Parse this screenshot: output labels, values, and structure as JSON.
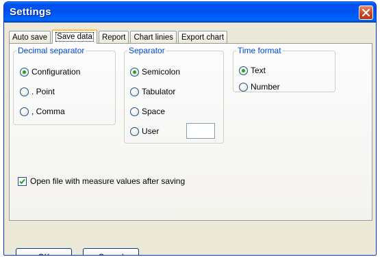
{
  "window": {
    "title": "Settings"
  },
  "tabs": [
    {
      "label": "Auto save"
    },
    {
      "label": "Save data"
    },
    {
      "label": "Report"
    },
    {
      "label": "Chart linies"
    },
    {
      "label": "Export chart"
    }
  ],
  "active_tab": "Save data",
  "decimal_separator": {
    "legend": "Decimal separator",
    "options": [
      {
        "label": "Configuration",
        "checked": true
      },
      {
        "label": ". Point",
        "checked": false
      },
      {
        "label": ", Comma",
        "checked": false
      }
    ]
  },
  "separator": {
    "legend": "Separator",
    "options": [
      {
        "label": "Semicolon",
        "checked": true
      },
      {
        "label": "Tabulator",
        "checked": false
      },
      {
        "label": "Space",
        "checked": false
      },
      {
        "label": "User",
        "checked": false
      }
    ],
    "user_value": ""
  },
  "time_format": {
    "legend": "Time format",
    "options": [
      {
        "label": "Text",
        "checked": true
      },
      {
        "label": "Number",
        "checked": false
      }
    ]
  },
  "open_file": {
    "label": "Open file with measure values after saving",
    "checked": true
  },
  "buttons": {
    "ok": "OK",
    "cancel": "Cancel"
  },
  "colors": {
    "title_bar": "#0054e3",
    "legend_text": "#0046d5",
    "radio_dot": "#21a121",
    "close_button": "#c8431e"
  }
}
